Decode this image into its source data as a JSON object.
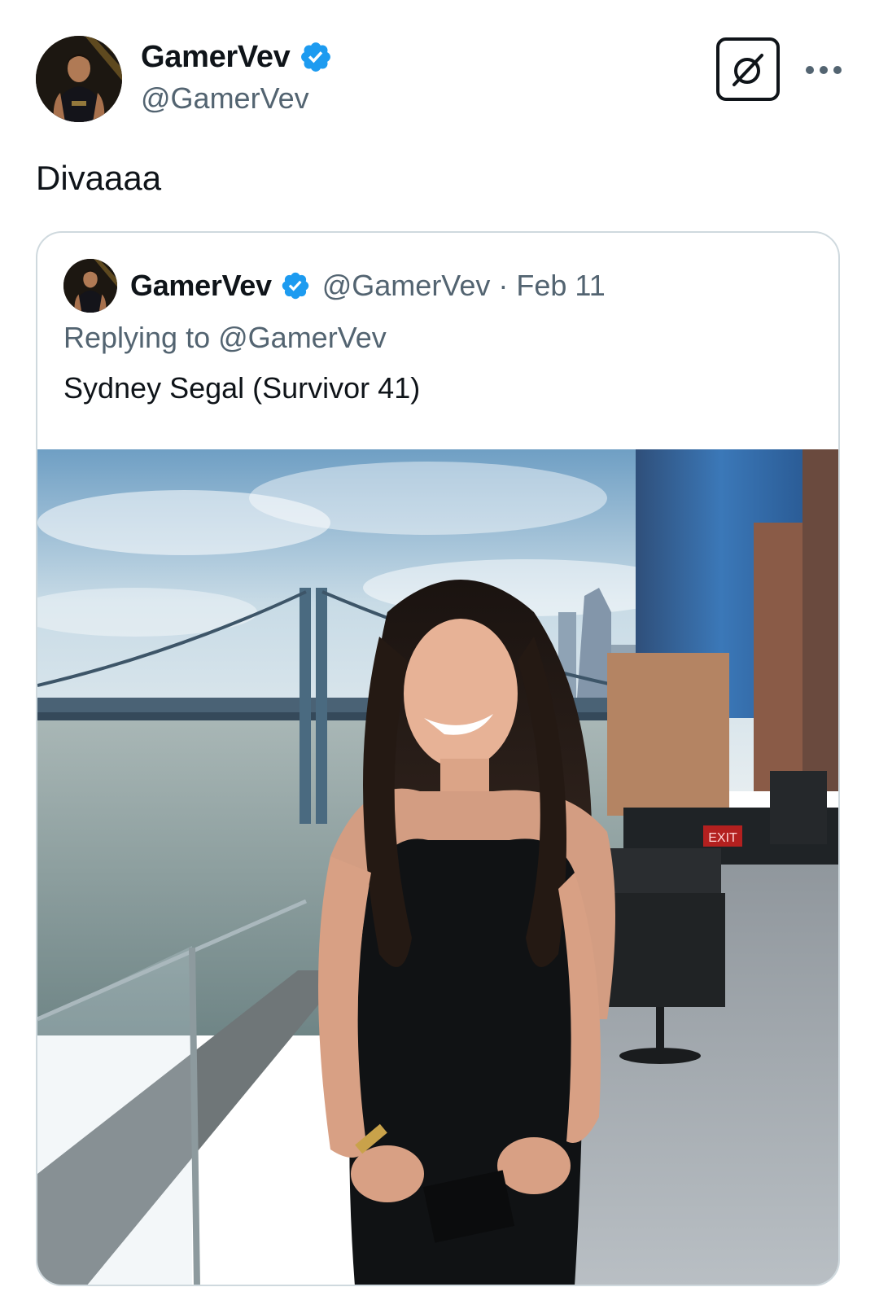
{
  "tweet": {
    "author": {
      "display_name": "GamerVev",
      "handle": "@GamerVev",
      "verified": true
    },
    "text": "Divaaaa",
    "icons": {
      "grok": "grok-icon",
      "more": "more-options-icon",
      "verified": "verified-badge-icon"
    }
  },
  "quoted_tweet": {
    "author": {
      "display_name": "GamerVev",
      "handle": "@GamerVev",
      "verified": true
    },
    "separator": "·",
    "date": "Feb 11",
    "replying_to_label": "Replying to",
    "replying_to_handle": "@GamerVev",
    "text": "Sydney Segal (Survivor 41)",
    "media": {
      "type": "photo",
      "sign_text": "EXIT"
    }
  },
  "colors": {
    "verified_blue": "#1d9bf0",
    "secondary_text": "#536471",
    "primary_text": "#0f1419",
    "card_border": "#cfd9de"
  }
}
